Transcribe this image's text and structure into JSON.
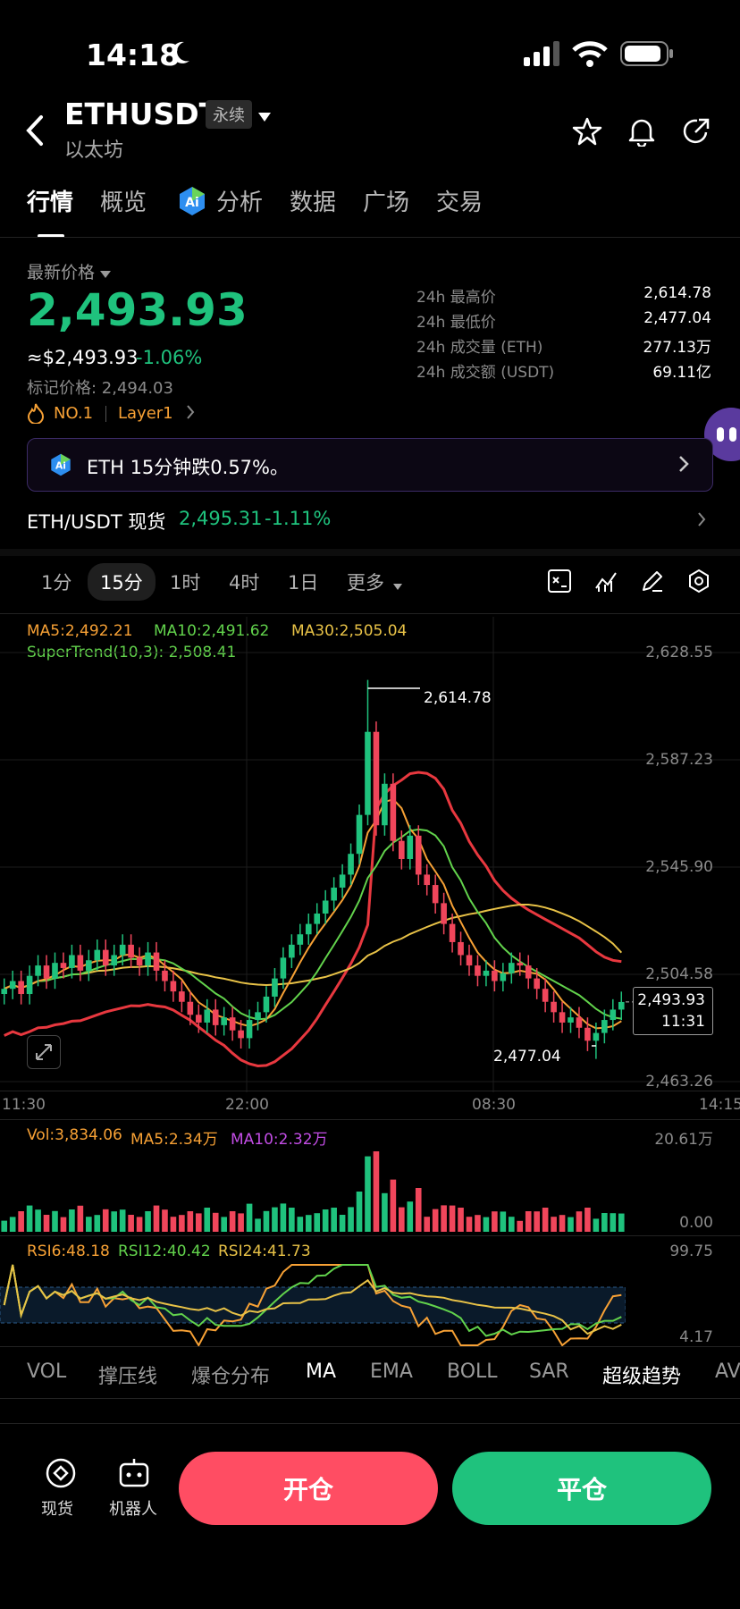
{
  "status_bar": {
    "time": "14:18"
  },
  "header": {
    "symbol": "ETHUSDT",
    "contract_type": "永续",
    "subtitle": "以太坊"
  },
  "tabs": [
    {
      "label": "行情",
      "active": true
    },
    {
      "label": "概览",
      "active": false
    },
    {
      "label": "分析",
      "active": false
    },
    {
      "label": "数据",
      "active": false
    },
    {
      "label": "广场",
      "active": false
    },
    {
      "label": "交易",
      "active": false
    }
  ],
  "price_panel": {
    "label": "最新价格",
    "price": "2,493.93",
    "usd_price": "≈$2,493.93",
    "change": "-1.06%",
    "mark_price": "标记价格: 2,494.03",
    "rank": "NO.1",
    "category": "Layer1",
    "stats": [
      {
        "label": "24h 最高价",
        "value": "2,614.78"
      },
      {
        "label": "24h 最低价",
        "value": "2,477.04"
      },
      {
        "label": "24h 成交量 (ETH)",
        "value": "277.13万"
      },
      {
        "label": "24h 成交额 (USDT)",
        "value": "69.11亿"
      }
    ]
  },
  "ai_banner": {
    "text": "ETH 15分钟跌0.57%。"
  },
  "spot_link": {
    "label": "ETH/USDT 现货",
    "price": "2,495.31",
    "change": "-1.11%"
  },
  "timeframes": [
    {
      "label": "1分",
      "active": false
    },
    {
      "label": "15分",
      "active": true
    },
    {
      "label": "1时",
      "active": false
    },
    {
      "label": "4时",
      "active": false
    },
    {
      "label": "1日",
      "active": false
    },
    {
      "label": "更多",
      "active": false
    }
  ],
  "chart_data": {
    "type": "candlestick",
    "indicators": {
      "ma5": "MA5:2,492.21",
      "ma10": "MA10:2,491.62",
      "ma30": "MA30:2,505.04",
      "supertrend": "SuperTrend(10,3): 2,508.41"
    },
    "y_ticks": [
      "2,628.55",
      "2,587.23",
      "2,545.90",
      "2,504.58",
      "2,463.26"
    ],
    "x_ticks": [
      "11:30",
      "22:00",
      "08:30",
      "14:15"
    ],
    "high_label": "2,614.78",
    "low_label": "2,477.04",
    "current_price": "2,493.93",
    "countdown": "11:31",
    "ylim": [
      2463.26,
      2628.55
    ],
    "closes": [
      2499,
      2502,
      2497,
      2504,
      2508,
      2503,
      2509,
      2507,
      2512,
      2506,
      2510,
      2514,
      2508,
      2512,
      2516,
      2511,
      2508,
      2513,
      2506,
      2502,
      2498,
      2494,
      2489,
      2486,
      2491,
      2485,
      2488,
      2483,
      2480,
      2487,
      2490,
      2496,
      2503,
      2511,
      2516,
      2520,
      2524,
      2528,
      2533,
      2538,
      2543,
      2551,
      2566,
      2598,
      2562,
      2578,
      2556,
      2549,
      2558,
      2543,
      2539,
      2532,
      2524,
      2517,
      2512,
      2508,
      2504,
      2506,
      2502,
      2505,
      2509,
      2508,
      2503,
      2499,
      2494,
      2490,
      2486,
      2488,
      2484,
      2479,
      2482,
      2487,
      2491,
      2493.93
    ],
    "volume": {
      "vol": "Vol:3,834.06",
      "ma5": "MA5:2.34万",
      "ma10": "MA10:2.32万",
      "max": "20.61万",
      "min": "0.00"
    },
    "rsi": {
      "rsi6": "RSI6:48.18",
      "rsi12": "RSI12:40.42",
      "rsi24": "RSI24:41.73",
      "max": "99.75",
      "min": "4.17"
    }
  },
  "indicator_tabs": [
    {
      "label": "VOL",
      "on": false
    },
    {
      "label": "撑压线",
      "on": false
    },
    {
      "label": "爆仓分布",
      "on": false
    },
    {
      "label": "MA",
      "on": true
    },
    {
      "label": "EMA",
      "on": false
    },
    {
      "label": "BOLL",
      "on": false
    },
    {
      "label": "SAR",
      "on": false
    },
    {
      "label": "超级趋势",
      "on": true
    },
    {
      "label": "AV",
      "on": false
    }
  ],
  "bottom_bar": {
    "spot": "现货",
    "robot": "机器人",
    "open": "开仓",
    "close": "平仓"
  },
  "colors": {
    "up": "#1fc27d",
    "down": "#f0465b",
    "accent": "#ff4d63"
  }
}
